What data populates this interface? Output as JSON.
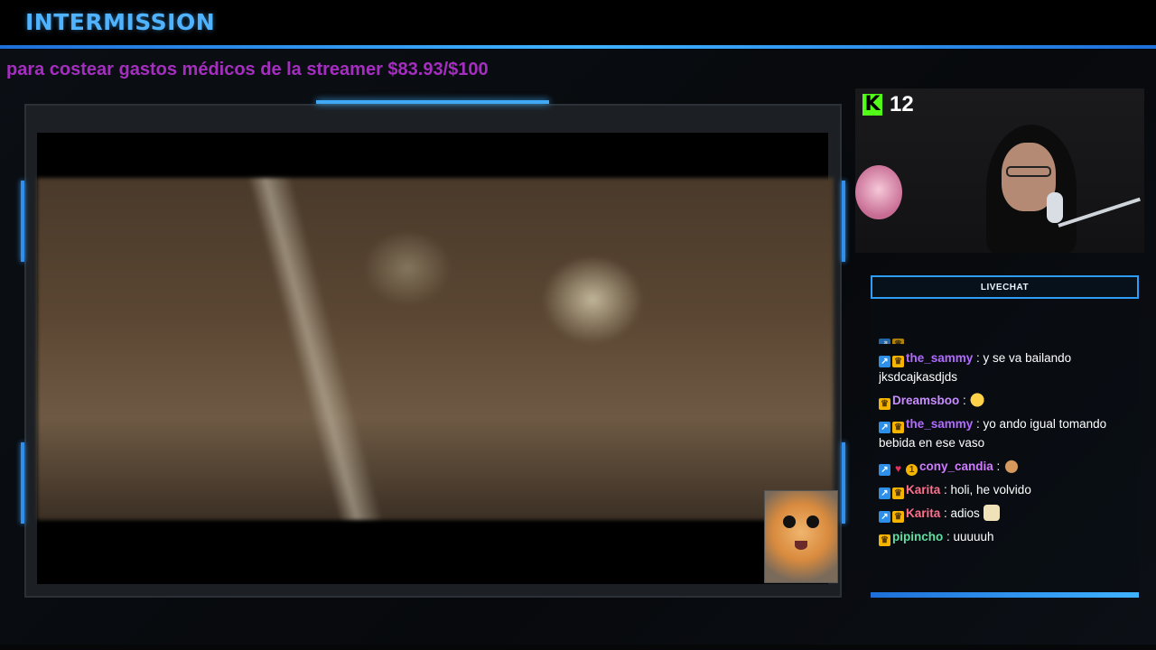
{
  "header": {
    "title": "INTERMISSION",
    "accent_color": "#4fb3ff"
  },
  "donation": {
    "text": "para costear gastos médicos de la streamer $83.93/$100",
    "color": "#a52ec0"
  },
  "video": {
    "scene": "blurred tabletop close-up",
    "overlay_cam": "cat-face-cam"
  },
  "webcam": {
    "viewer_count": "12",
    "platform_icon": "kick-icon",
    "platform_color": "#53fc18"
  },
  "chat": {
    "header": "LIVECHAT",
    "messages": [
      {
        "user": "the_sammy",
        "color": "#b26bff",
        "text": " : y se va bailando jksdcajkasdjds",
        "badges": [
          "boost",
          "crown"
        ],
        "emote": ""
      },
      {
        "user": "Dreamsboo",
        "color": "#c98cff",
        "text": " : ",
        "badges": [
          "crown"
        ],
        "emote": "pacman"
      },
      {
        "user": "the_sammy",
        "color": "#b26bff",
        "text": " : yo ando igual tomando bebida en ese vaso",
        "badges": [
          "boost",
          "crown"
        ],
        "emote": ""
      },
      {
        "user": "cony_candia",
        "color": "#d07bff",
        "text": " : ",
        "badges": [
          "boost",
          "heart",
          "gift"
        ],
        "emote": "cat"
      },
      {
        "user": "Karita",
        "color": "#ff6f8a",
        "text": " : holi, he volvido",
        "badges": [
          "boost",
          "crown"
        ],
        "emote": ""
      },
      {
        "user": "Karita",
        "color": "#ff6f8a",
        "text": " : adios ",
        "badges": [
          "boost",
          "crown"
        ],
        "emote": "cream"
      },
      {
        "user": "pipincho",
        "color": "#5fe0a0",
        "text": " : uuuuuh",
        "badges": [
          "crown"
        ],
        "emote": ""
      }
    ]
  }
}
